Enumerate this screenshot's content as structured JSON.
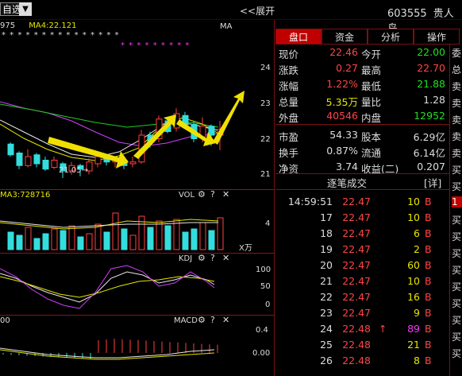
{
  "topbar": {
    "watchlist": "自选",
    "dropdown_arrow": "▼",
    "expand_label": "<<展开",
    "stock_code": "603555",
    "stock_name": "贵人鸟"
  },
  "kline": {
    "header_left": "975",
    "ma4_label": "MA4:22.121",
    "corner_label": "MA",
    "star_row1": "* * *    * * *    * * *    * * *    * * *",
    "star_row2": "*    * * * * * *    * *",
    "price_ticks": [
      "24",
      "23",
      "22",
      "21"
    ],
    "low_marker": "21.05",
    "candles": [
      {
        "o": 22.05,
        "c": 21.75,
        "h": 22.1,
        "l": 21.7
      },
      {
        "o": 21.8,
        "c": 21.45,
        "h": 21.85,
        "l": 21.35
      },
      {
        "o": 21.45,
        "c": 21.7,
        "h": 21.9,
        "l": 21.4
      },
      {
        "o": 21.75,
        "c": 21.5,
        "h": 21.8,
        "l": 21.4
      },
      {
        "o": 21.6,
        "c": 21.35,
        "h": 21.7,
        "l": 21.3
      },
      {
        "o": 21.4,
        "c": 21.6,
        "h": 21.7,
        "l": 21.35
      },
      {
        "o": 21.5,
        "c": 21.3,
        "h": 21.55,
        "l": 21.1
      },
      {
        "o": 21.3,
        "c": 21.45,
        "h": 21.55,
        "l": 21.2
      },
      {
        "o": 21.45,
        "c": 21.35,
        "h": 21.5,
        "l": 21.15
      },
      {
        "o": 21.3,
        "c": 21.55,
        "h": 21.65,
        "l": 21.2
      },
      {
        "o": 21.5,
        "c": 21.7,
        "h": 21.75,
        "l": 21.4
      },
      {
        "o": 21.65,
        "c": 21.55,
        "h": 21.7,
        "l": 21.45
      },
      {
        "o": 21.55,
        "c": 21.6,
        "h": 21.7,
        "l": 21.4
      },
      {
        "o": 21.6,
        "c": 21.45,
        "h": 21.65,
        "l": 21.35
      },
      {
        "o": 21.5,
        "c": 21.55,
        "h": 21.7,
        "l": 21.4
      },
      {
        "o": 21.55,
        "c": 22.3,
        "h": 22.45,
        "l": 21.5
      },
      {
        "o": 22.3,
        "c": 22.1,
        "h": 22.4,
        "l": 21.95
      },
      {
        "o": 22.2,
        "c": 22.75,
        "h": 22.85,
        "l": 22.1
      },
      {
        "o": 22.7,
        "c": 22.4,
        "h": 22.8,
        "l": 22.35
      },
      {
        "o": 22.5,
        "c": 22.9,
        "h": 23.05,
        "l": 22.4
      },
      {
        "o": 22.85,
        "c": 22.6,
        "h": 22.95,
        "l": 22.5
      },
      {
        "o": 22.6,
        "c": 22.2,
        "h": 22.7,
        "l": 22.1
      },
      {
        "o": 22.25,
        "c": 22.55,
        "h": 22.8,
        "l": 22.1
      },
      {
        "o": 22.55,
        "c": 22.3,
        "h": 22.6,
        "l": 22.0
      },
      {
        "o": 22.3,
        "c": 22.46,
        "h": 22.7,
        "l": 21.88
      }
    ]
  },
  "volume": {
    "header": "MA3:728716",
    "label": "VOL",
    "unit": "X万",
    "tick": "4"
  },
  "kdj": {
    "label": "KDJ",
    "tick_top": "100",
    "tick_mid": "50",
    "tick_zero": "0"
  },
  "macd": {
    "header": "00",
    "label": "MACD",
    "tick_top": "0.4",
    "tick_zero": "0.00"
  },
  "tabs": [
    "盘口",
    "资金",
    "分析",
    "操作"
  ],
  "quote": {
    "rows": [
      {
        "l1": "现价",
        "v1": "22.46",
        "c1": "red",
        "l2": "今开",
        "v2": "22.00",
        "c2": "green"
      },
      {
        "l1": "涨跌",
        "v1": "0.27",
        "c1": "red",
        "l2": "最高",
        "v2": "22.70",
        "c2": "red"
      },
      {
        "l1": "涨幅",
        "v1": "1.22%",
        "c1": "red",
        "l2": "最低",
        "v2": "21.88",
        "c2": "green"
      },
      {
        "l1": "总量",
        "v1": "5.35万",
        "c1": "yellow",
        "l2": "量比",
        "v2": "1.28",
        "c2": "white"
      },
      {
        "l1": "外盘",
        "v1": "40546",
        "c1": "red",
        "l2": "内盘",
        "v2": "12952",
        "c2": "green"
      },
      {
        "l1": "市盈",
        "v1": "54.33",
        "c1": "white",
        "l2": "股本",
        "v2": "6.29亿",
        "c2": "white"
      },
      {
        "l1": "换手",
        "v1": "0.87%",
        "c1": "white",
        "l2": "流通",
        "v2": "6.14亿",
        "c2": "white"
      },
      {
        "l1": "净资",
        "v1": "3.74",
        "c1": "white",
        "l2": "收益(二)",
        "v2": "0.207",
        "c2": "white"
      }
    ]
  },
  "trades_header": {
    "title": "逐笔成交",
    "detail": "[详]"
  },
  "trades": [
    {
      "t": "14:59:51",
      "p": "22.47",
      "v": "10",
      "bs": "B",
      "vc": "yellow",
      "mark": ""
    },
    {
      "t": "17",
      "p": "22.47",
      "v": "10",
      "bs": "B",
      "vc": "yellow",
      "mark": ""
    },
    {
      "t": "18",
      "p": "22.47",
      "v": "6",
      "bs": "B",
      "vc": "yellow",
      "mark": ""
    },
    {
      "t": "19",
      "p": "22.47",
      "v": "2",
      "bs": "B",
      "vc": "yellow",
      "mark": ""
    },
    {
      "t": "20",
      "p": "22.47",
      "v": "60",
      "bs": "B",
      "vc": "yellow",
      "mark": ""
    },
    {
      "t": "21",
      "p": "22.47",
      "v": "10",
      "bs": "B",
      "vc": "yellow",
      "mark": ""
    },
    {
      "t": "22",
      "p": "22.47",
      "v": "16",
      "bs": "B",
      "vc": "yellow",
      "mark": ""
    },
    {
      "t": "23",
      "p": "22.47",
      "v": "9",
      "bs": "B",
      "vc": "yellow",
      "mark": ""
    },
    {
      "t": "24",
      "p": "22.48",
      "v": "89",
      "bs": "B",
      "vc": "magenta",
      "mark": "↑"
    },
    {
      "t": "25",
      "p": "22.48",
      "v": "21",
      "bs": "B",
      "vc": "yellow",
      "mark": ""
    },
    {
      "t": "26",
      "p": "22.48",
      "v": "8",
      "bs": "B",
      "vc": "yellow",
      "mark": ""
    }
  ],
  "sidebar_chars": [
    "委",
    "总",
    "卖",
    "卖",
    "卖",
    "卖",
    "卖",
    "买",
    "买",
    "1",
    "买",
    "买",
    "买",
    "买",
    "买",
    "买",
    "买",
    "买",
    "买"
  ]
}
